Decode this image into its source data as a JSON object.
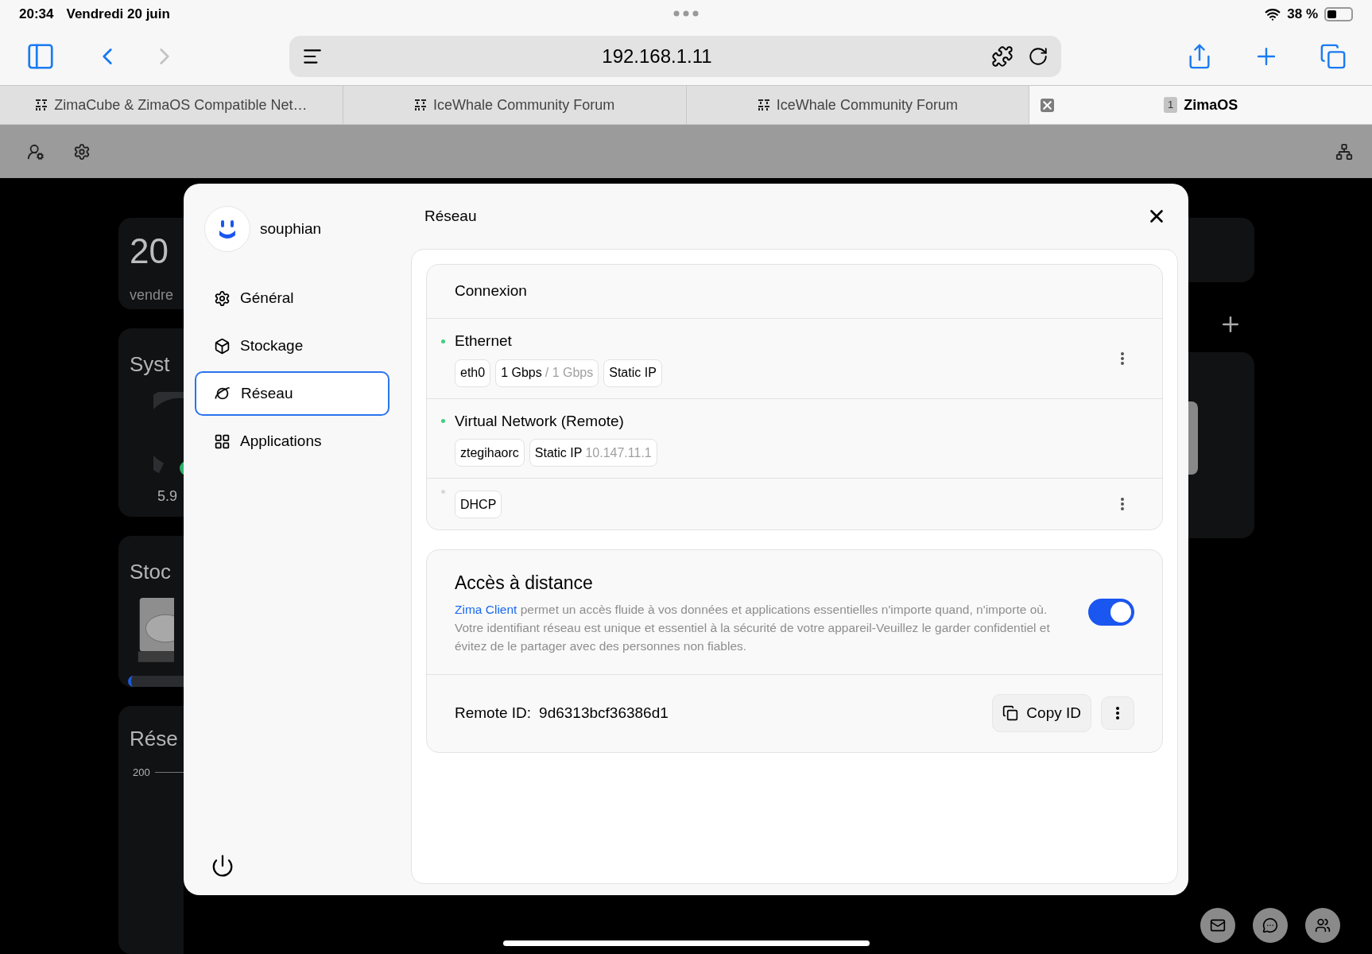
{
  "status_bar": {
    "time": "20:34",
    "date": "Vendredi 20 juin",
    "battery_text": "38 %"
  },
  "browser": {
    "url": "192.168.1.11",
    "tabs": [
      {
        "label": "ZimaCube & ZimaOS Compatible Net…",
        "selected": false
      },
      {
        "label": "IceWhale Community Forum",
        "selected": false
      },
      {
        "label": "IceWhale Community Forum",
        "selected": false
      },
      {
        "label": "ZimaOS",
        "badge": "1",
        "selected": true
      }
    ]
  },
  "dashboard": {
    "left_cards": [
      {
        "kind": "clock",
        "title": "20",
        "subtitle": "vendre"
      },
      {
        "kind": "gauge",
        "title": "Syst",
        "reading": "5.9"
      },
      {
        "kind": "storage",
        "title": "Stoc"
      },
      {
        "kind": "chart",
        "title": "Rése",
        "tick": "200"
      }
    ]
  },
  "settings_dialog": {
    "user": {
      "name": "souphian"
    },
    "menu": [
      {
        "label": "Général",
        "selected": false
      },
      {
        "label": "Stockage",
        "selected": false
      },
      {
        "label": "Réseau",
        "selected": true
      },
      {
        "label": "Applications",
        "selected": false
      }
    ],
    "title": "Réseau",
    "connexion": {
      "title": "Connexion",
      "interfaces": [
        {
          "name": "Ethernet",
          "connected": true,
          "has_menu": true,
          "tags": [
            {
              "text": "eth0"
            },
            {
              "text": "1 Gbps",
              "secondary": "/ 1 Gbps"
            },
            {
              "text": "Static IP"
            }
          ]
        },
        {
          "name": "Virtual Network (Remote)",
          "connected": true,
          "has_menu": false,
          "tags": [
            {
              "text": "ztegihaorc"
            },
            {
              "text": "Static IP",
              "secondary": "10.147.11.1"
            }
          ]
        },
        {
          "connected": false,
          "has_menu": true,
          "tags": [
            {
              "text": "DHCP"
            }
          ]
        }
      ]
    },
    "remote_access": {
      "title": "Accès à distance",
      "link": "Zima Client",
      "description": "permet un accès fluide à vos données et applications essentielles n'importe quand, n'importe où. Votre identifiant réseau est unique et essentiel à la sécurité de votre appareil-Veuillez le garder confidentiel et évitez de le partager avec des personnes non fiables.",
      "on": true,
      "remote_id_label": "Remote ID:",
      "remote_id": "9d6313bcf36386d1",
      "copy_button": "Copy ID"
    }
  }
}
